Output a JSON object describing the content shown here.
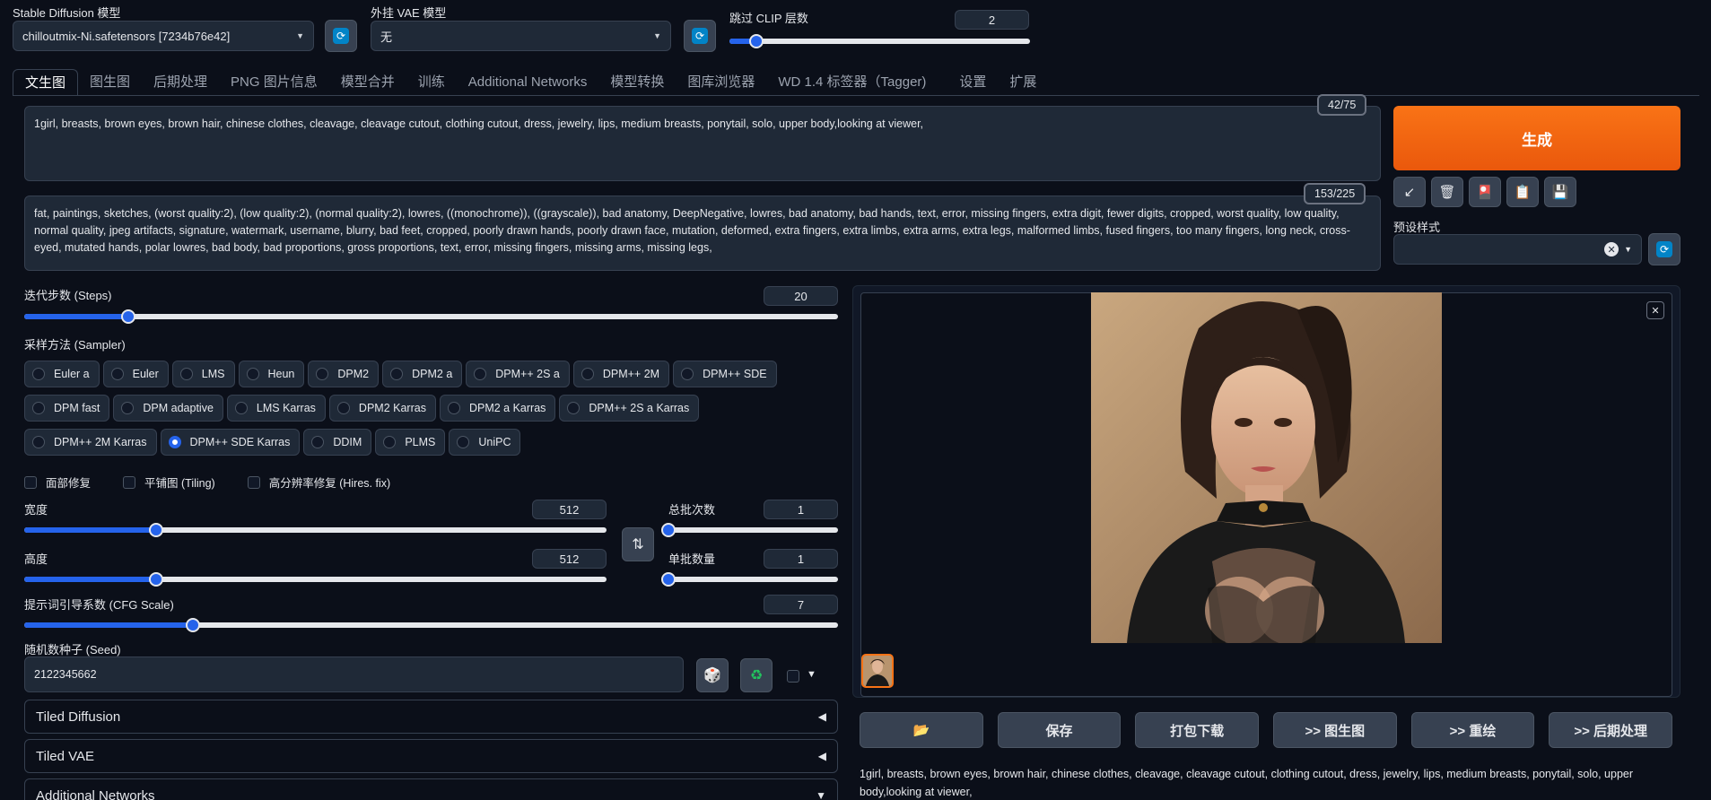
{
  "model": {
    "label": "Stable Diffusion 模型",
    "value": "chilloutmix-Ni.safetensors [7234b76e42]"
  },
  "vae": {
    "label": "外挂 VAE 模型",
    "value": "无"
  },
  "clip": {
    "label": "跳过 CLIP 层数",
    "value": "2",
    "level": 2,
    "min": 1,
    "max": 12
  },
  "tabs": [
    {
      "label": "文生图"
    },
    {
      "label": "图生图"
    },
    {
      "label": "后期处理"
    },
    {
      "label": "PNG 图片信息"
    },
    {
      "label": "模型合并"
    },
    {
      "label": "训练"
    },
    {
      "label": "Additional Networks"
    },
    {
      "label": "模型转换"
    },
    {
      "label": "图库浏览器"
    },
    {
      "label": "WD 1.4 标签器（Tagger)"
    },
    {
      "label": "设置"
    },
    {
      "label": "扩展"
    }
  ],
  "prompt": {
    "counter": "42/75",
    "text": "1girl, breasts, brown eyes, brown hair, chinese clothes, cleavage, cleavage cutout, clothing cutout, dress, jewelry, lips, medium breasts, ponytail, solo, upper body,looking at viewer,"
  },
  "negative": {
    "counter": "153/225",
    "text": "fat, paintings, sketches, (worst quality:2), (low quality:2), (normal quality:2), lowres, ((monochrome)), ((grayscale)), bad anatomy, DeepNegative, lowres, bad anatomy, bad hands, text, error, missing fingers, extra digit, fewer digits, cropped, worst quality, low quality, normal quality, jpeg artifacts, signature, watermark, username, blurry, bad feet, cropped, poorly drawn hands, poorly drawn face, mutation, deformed, extra fingers, extra limbs, extra arms, extra legs, malformed limbs, fused fingers, too many fingers, long neck, cross-eyed, mutated hands, polar lowres, bad body, bad proportions, gross proportions, text, error, missing fingers, missing arms, missing legs,"
  },
  "generate_label": "生成",
  "styles": {
    "label": "预设样式",
    "value": ""
  },
  "steps": {
    "label": "迭代步数 (Steps)",
    "value": "20",
    "level": 20,
    "min": 1,
    "max": 150
  },
  "sampler": {
    "label": "采样方法 (Sampler)",
    "selected": "DPM++ SDE Karras",
    "rows": [
      [
        "Euler a",
        "Euler",
        "LMS",
        "Heun",
        "DPM2",
        "DPM2 a",
        "DPM++ 2S a",
        "DPM++ 2M",
        "DPM++ SDE"
      ],
      [
        "DPM fast",
        "DPM adaptive",
        "LMS Karras",
        "DPM2 Karras",
        "DPM2 a Karras",
        "DPM++ 2S a Karras"
      ],
      [
        "DPM++ 2M Karras",
        "DPM++ SDE Karras",
        "DDIM",
        "PLMS",
        "UniPC"
      ]
    ]
  },
  "checkboxes": {
    "face": "面部修复",
    "tiling": "平铺图 (Tiling)",
    "hires": "高分辨率修复 (Hires. fix)"
  },
  "width": {
    "label": "宽度",
    "value": "512",
    "level": 512,
    "min": 64,
    "max": 2048
  },
  "height": {
    "label": "高度",
    "value": "512",
    "level": 512,
    "min": 64,
    "max": 2048
  },
  "batch_count": {
    "label": "总批次数",
    "value": "1",
    "level": 1,
    "min": 1,
    "max": 100
  },
  "batch_size": {
    "label": "单批数量",
    "value": "1",
    "level": 1,
    "min": 1,
    "max": 8
  },
  "cfg": {
    "label": "提示词引导系数 (CFG Scale)",
    "value": "7",
    "level": 7,
    "min": 1,
    "max": 30
  },
  "seed": {
    "label": "随机数种子 (Seed)",
    "value": "2122345662"
  },
  "accordions": {
    "tiled_diffusion": "Tiled Diffusion",
    "tiled_vae": "Tiled VAE",
    "additional_networks": "Additional Networks"
  },
  "actions": {
    "folder": "📂",
    "save": "保存",
    "zip": "打包下载",
    "to_img2img": ">> 图生图",
    "to_inpaint": ">> 重绘",
    "to_extras": ">> 后期处理"
  },
  "output_info": "1girl, breasts, brown eyes, brown hair, chinese clothes, cleavage, cleavage cutout, clothing cutout, dress, jewelry, lips, medium breasts, ponytail, solo, upper body,looking at viewer,",
  "colors": {
    "accent": "#2563eb",
    "generate": "#f97316",
    "background": "#0b0f19",
    "panel": "#1f2937"
  }
}
